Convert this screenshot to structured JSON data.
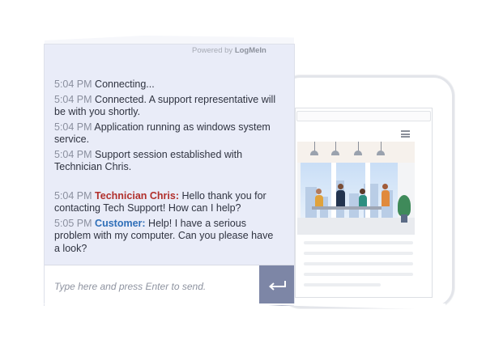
{
  "powered_by": {
    "prefix": "Powered by",
    "brand": "LogMeIn"
  },
  "messages": [
    {
      "time": "5:04 PM",
      "sender": "",
      "text": "Connecting..."
    },
    {
      "time": "5:04 PM",
      "sender": "",
      "text": "Connected. A support representative will be with you shortly."
    },
    {
      "time": "5:04 PM",
      "sender": "",
      "text": "Application running as windows system service."
    },
    {
      "time": "5:04 PM",
      "sender": "",
      "text": "Support session established with Technician Chris."
    },
    {
      "time": "5:04 PM",
      "sender": "Technician Chris:",
      "text": "Hello thank you for contacting Tech Support! How can I help?"
    },
    {
      "time": "5:05 PM",
      "sender": "Customer:",
      "text": "Help! I have a serious problem with my computer. Can you please have a look?"
    }
  ],
  "input": {
    "placeholder": "Type here and press Enter to send.",
    "value": ""
  },
  "send_button": {
    "icon": "enter-arrow-icon"
  },
  "colors": {
    "panel_bg": "#e9ecf8",
    "send_button": "#7d86a6",
    "technician_name": "#b1302c",
    "customer_name": "#2f6fb8"
  }
}
